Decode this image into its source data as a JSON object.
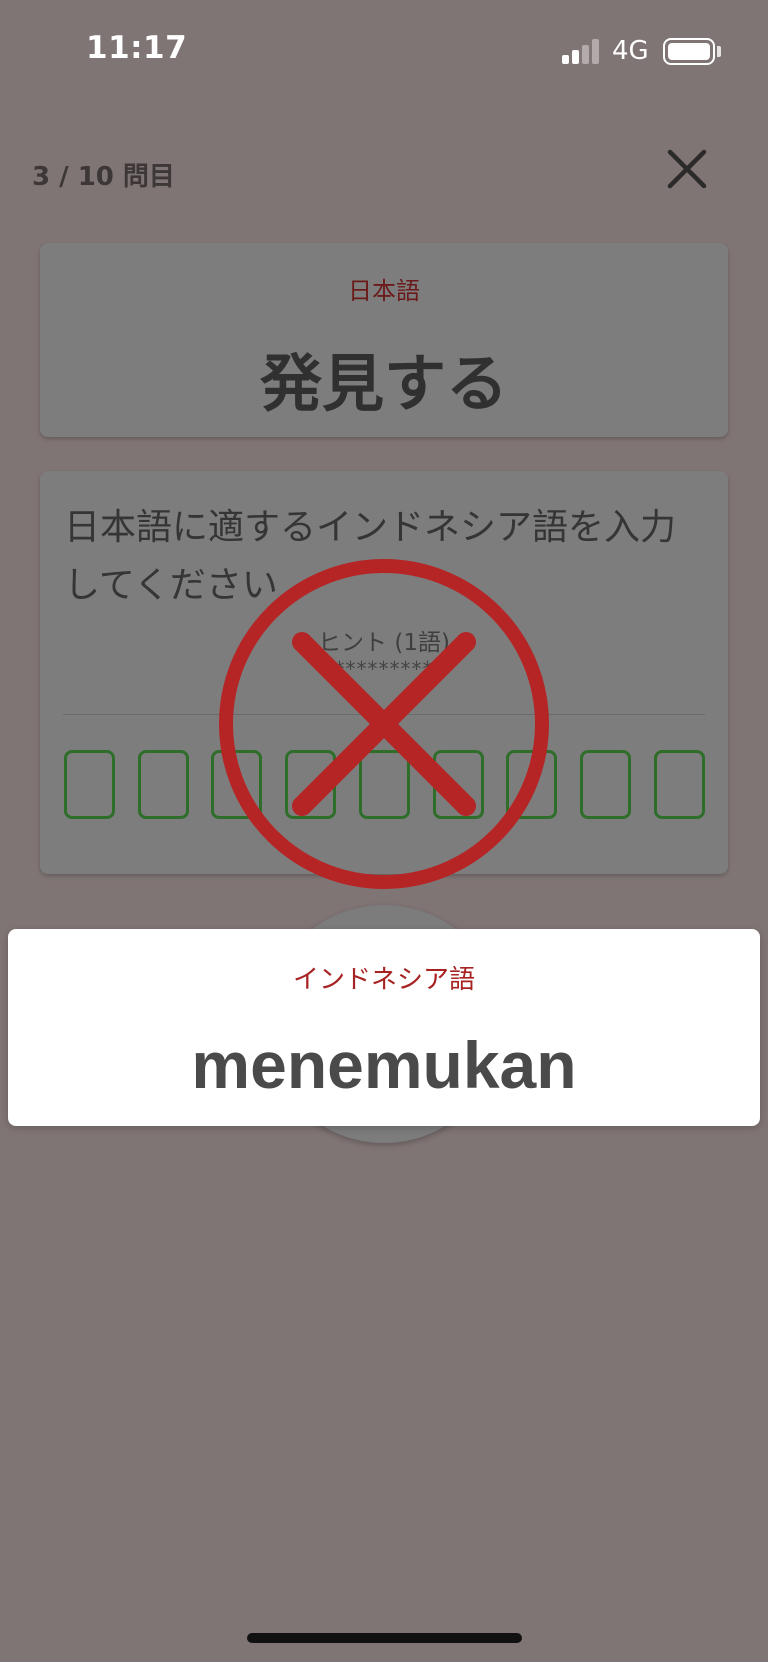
{
  "status_bar": {
    "time": "11:17",
    "network": "4G",
    "icons": [
      "cellular-signal-icon",
      "battery-icon"
    ]
  },
  "quiz": {
    "progress": "3 / 10 問目",
    "close_icon": "close-icon"
  },
  "prompt": {
    "language_label": "日本語",
    "word": "発見する"
  },
  "input": {
    "instruction": "日本語に適するインドネシア語を入力してください",
    "hint_label": "ヒント (1語)",
    "hint_mask": "*********",
    "letter_slots": 9
  },
  "feedback": {
    "result_icon": "wrong-x-icon",
    "answer_language_label": "インドネシア語",
    "answer_word": "menemukan"
  },
  "colors": {
    "overlay_background": "#807575",
    "wrong_mark": "#b62525",
    "answer_language": "#a72323",
    "slot_border": "#2e6e2a"
  }
}
